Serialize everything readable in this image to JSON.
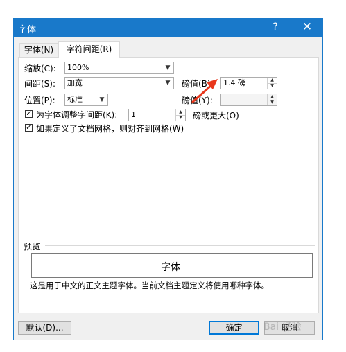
{
  "window": {
    "title": "字体",
    "help": "?",
    "close": "✕"
  },
  "tabs": [
    "字体(N)",
    "字符间距(R)"
  ],
  "fields": {
    "scale_label": "缩放(C):",
    "scale_value": "100%",
    "spacing_label": "间距(S):",
    "spacing_value": "加宽",
    "spacing_by_label": "磅值(B):",
    "spacing_by_value": "1.4 磅",
    "position_label": "位置(P):",
    "position_value": "标准",
    "position_by_label": "磅值(Y):",
    "position_by_value": "",
    "kerning_label": "为字体调整字间距(K):",
    "kerning_value": "1",
    "kerning_suffix": "磅或更大(O)",
    "grid_label": "如果定义了文档网格，则对齐到网格(W)"
  },
  "checkboxes": {
    "kerning_checked": true,
    "grid_checked": true,
    "check_glyph": "✓"
  },
  "preview": {
    "label": "预览",
    "sample": "字体",
    "description": "这是用于中文的正文主题字体。当前文档主题定义将使用哪种字体。"
  },
  "buttons": {
    "default": "默认(D)...",
    "ok": "确定",
    "cancel": "取消"
  },
  "watermark": "Bai 经验",
  "colors": {
    "titlebar": "#1979ca",
    "annotation_arrow": "#e8371c"
  },
  "icons": {
    "dropdown": "chevron-down-icon",
    "spin_up": "up-arrow-icon",
    "spin_down": "down-arrow-icon"
  }
}
